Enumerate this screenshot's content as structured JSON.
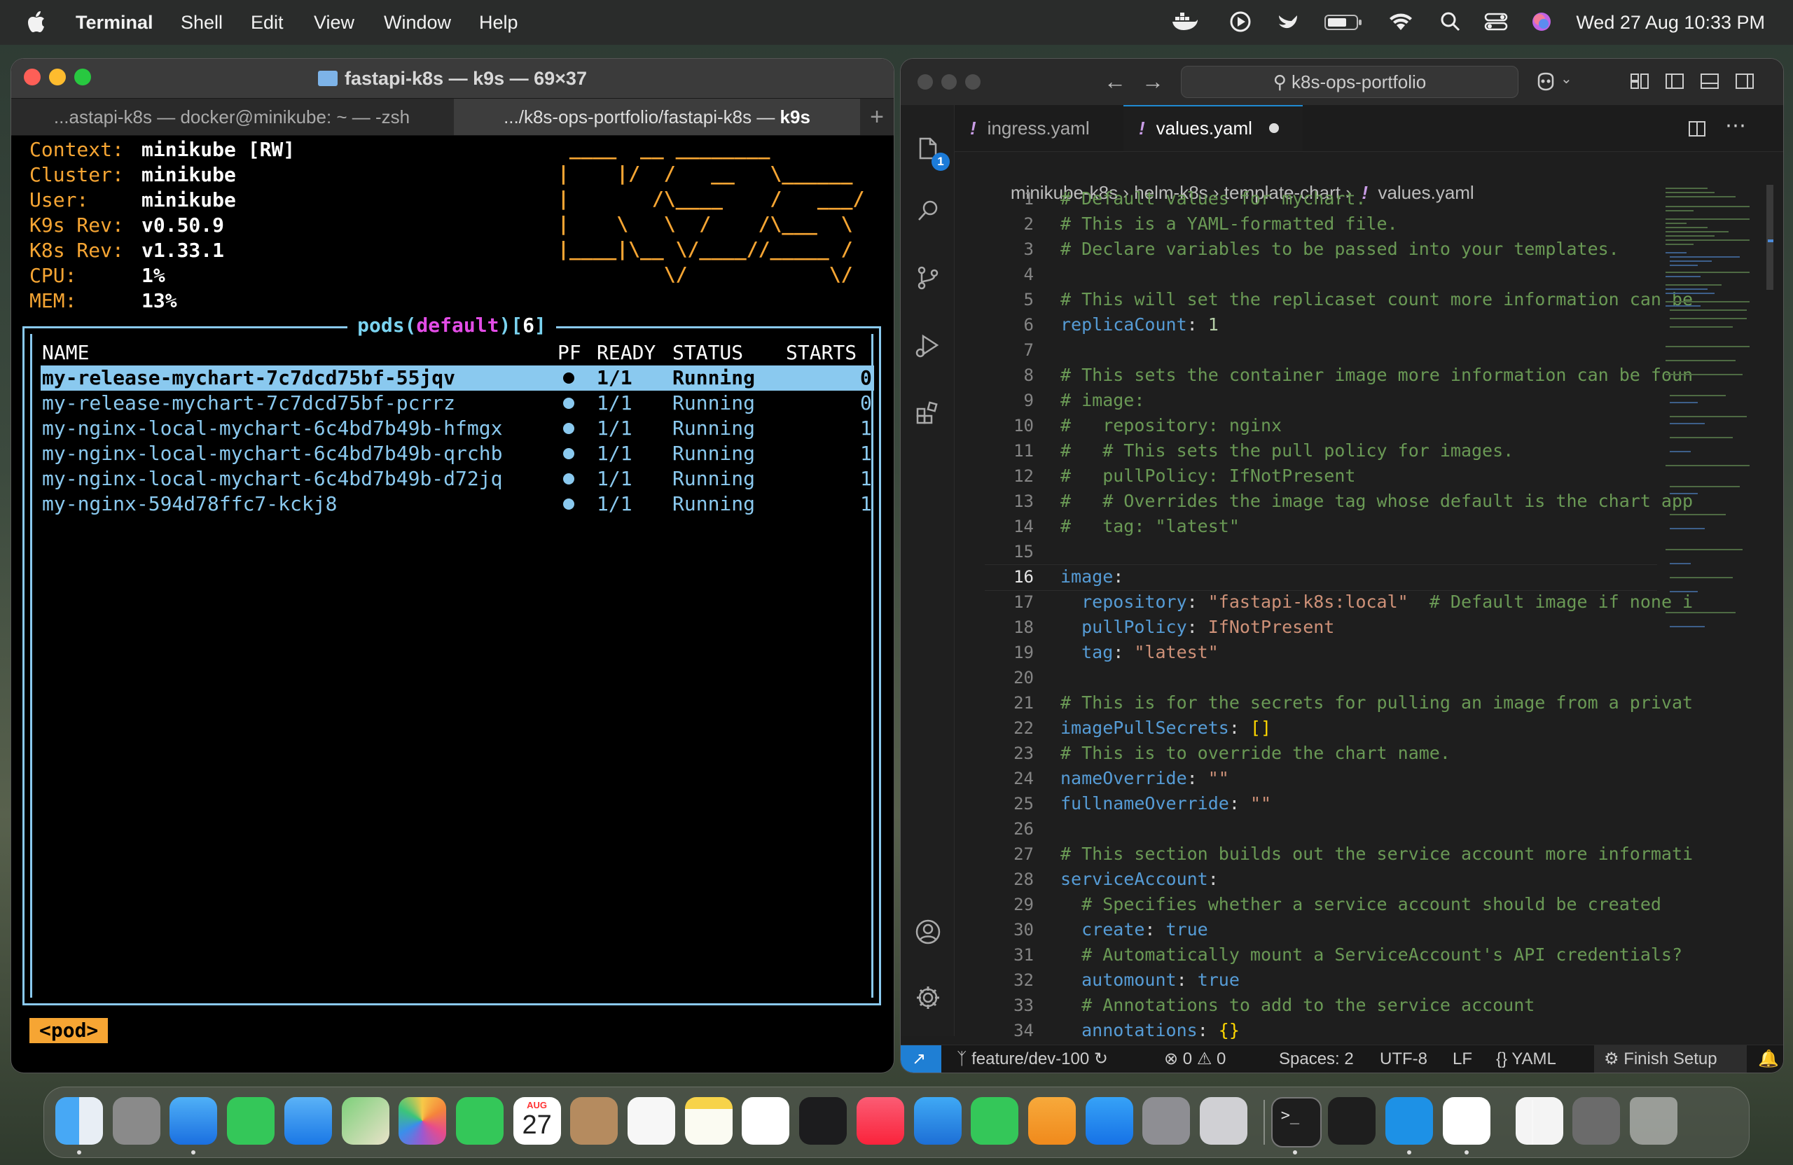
{
  "menubar": {
    "app": "Terminal",
    "items": [
      "Shell",
      "Edit",
      "View",
      "Window",
      "Help"
    ],
    "clock": "Wed 27 Aug  10:33 PM",
    "status_icons": [
      "docker-whale-icon",
      "play-circle-icon",
      "bird-icon",
      "battery-icon",
      "wifi-icon",
      "search-icon",
      "control-center-icon",
      "siri-icon"
    ]
  },
  "terminal": {
    "title": "fastapi-k8s — k9s — 69×37",
    "tabs": [
      {
        "label": "...astapi-k8s — docker@minikube: ~ — -zsh"
      },
      {
        "label": ".../k8s-ops-portfolio/fastapi-k8s — ",
        "tag": "k9s"
      }
    ],
    "info": [
      {
        "label": "Context:",
        "value": "minikube [RW]"
      },
      {
        "label": "Cluster:",
        "value": "minikube"
      },
      {
        "label": "User:",
        "value": "minikube"
      },
      {
        "label": "K9s Rev:",
        "value": "v0.50.9"
      },
      {
        "label": "K8s Rev:",
        "value": "v1.33.1"
      },
      {
        "label": "CPU:",
        "value": "1%"
      },
      {
        "label": "MEM:",
        "value": "13%"
      }
    ],
    "logo": " ____  __ ________        \n|    |/  /   __   \\______ \n|       /\\____    /   ___/\n|    \\   \\  /    /\\___  \\ \n|____|\\__ \\/____//_____ / \n         \\/            \\/  ",
    "pods_title": {
      "word": "pods",
      "ns": "default",
      "count": "6"
    },
    "columns": {
      "name": "NAME",
      "pf": "PF",
      "ready": "READY",
      "status": "STATUS",
      "starts": "STARTS"
    },
    "pods": [
      {
        "name": "my-release-mychart-7c7dcd75bf-55jqv",
        "ready": "1/1",
        "status": "Running",
        "starts": "0"
      },
      {
        "name": "my-release-mychart-7c7dcd75bf-pcrrz",
        "ready": "1/1",
        "status": "Running",
        "starts": "0"
      },
      {
        "name": "my-nginx-local-mychart-6c4bd7b49b-hfmgx",
        "ready": "1/1",
        "status": "Running",
        "starts": "1"
      },
      {
        "name": "my-nginx-local-mychart-6c4bd7b49b-qrchb",
        "ready": "1/1",
        "status": "Running",
        "starts": "1"
      },
      {
        "name": "my-nginx-local-mychart-6c4bd7b49b-d72jq",
        "ready": "1/1",
        "status": "Running",
        "starts": "1"
      },
      {
        "name": "my-nginx-594d78ffc7-kckj8",
        "ready": "1/1",
        "status": "Running",
        "starts": "1"
      }
    ],
    "crumb": "<pod>"
  },
  "vscode": {
    "search": "k8s-ops-portfolio",
    "explorer_badge": "1",
    "tabs": [
      {
        "label": "ingress.yaml",
        "active": false
      },
      {
        "label": "values.yaml",
        "active": true,
        "modified": true
      }
    ],
    "breadcrumb": [
      "minikube-k8s",
      "helm-k8s",
      "template-chart",
      "values.yaml"
    ],
    "current_line": "16",
    "lines": [
      [
        [
          "c-com",
          "# Default values for mychart."
        ]
      ],
      [
        [
          "c-com",
          "# This is a YAML-formatted file."
        ]
      ],
      [
        [
          "c-com",
          "# Declare variables to be passed into your templates."
        ]
      ],
      [],
      [
        [
          "c-com",
          "# This will set the replicaset count more information can be"
        ]
      ],
      [
        [
          "c-key",
          "replicaCount"
        ],
        [
          "c-plain",
          ": "
        ],
        [
          "c-num",
          "1"
        ]
      ],
      [],
      [
        [
          "c-com",
          "# This sets the container image more information can be foun"
        ]
      ],
      [
        [
          "c-com",
          "# image:"
        ]
      ],
      [
        [
          "c-com",
          "#   repository: nginx"
        ]
      ],
      [
        [
          "c-com",
          "#   # This sets the pull policy for images."
        ]
      ],
      [
        [
          "c-com",
          "#   pullPolicy: IfNotPresent"
        ]
      ],
      [
        [
          "c-com",
          "#   # Overrides the image tag whose default is the chart app"
        ]
      ],
      [
        [
          "c-com",
          "#   tag: \"latest\""
        ]
      ],
      [],
      [
        [
          "c-key",
          "image"
        ],
        [
          "c-plain",
          ":"
        ]
      ],
      [
        [
          "c-plain",
          "  "
        ],
        [
          "c-key",
          "repository"
        ],
        [
          "c-plain",
          ": "
        ],
        [
          "c-str",
          "\"fastapi-k8s:local\""
        ],
        [
          "c-plain",
          "  "
        ],
        [
          "c-com",
          "# Default image if none i"
        ]
      ],
      [
        [
          "c-plain",
          "  "
        ],
        [
          "c-key",
          "pullPolicy"
        ],
        [
          "c-plain",
          ": "
        ],
        [
          "c-str",
          "IfNotPresent"
        ]
      ],
      [
        [
          "c-plain",
          "  "
        ],
        [
          "c-key",
          "tag"
        ],
        [
          "c-plain",
          ": "
        ],
        [
          "c-str",
          "\"latest\""
        ]
      ],
      [],
      [
        [
          "c-com",
          "# This is for the secrets for pulling an image from a privat"
        ]
      ],
      [
        [
          "c-key",
          "imagePullSecrets"
        ],
        [
          "c-plain",
          ": "
        ],
        [
          "c-br",
          "[]"
        ]
      ],
      [
        [
          "c-com",
          "# This is to override the chart name."
        ]
      ],
      [
        [
          "c-key",
          "nameOverride"
        ],
        [
          "c-plain",
          ": "
        ],
        [
          "c-str",
          "\"\""
        ]
      ],
      [
        [
          "c-key",
          "fullnameOverride"
        ],
        [
          "c-plain",
          ": "
        ],
        [
          "c-str",
          "\"\""
        ]
      ],
      [],
      [
        [
          "c-com",
          "# This section builds out the service account more informati"
        ]
      ],
      [
        [
          "c-key",
          "serviceAccount"
        ],
        [
          "c-plain",
          ":"
        ]
      ],
      [
        [
          "c-plain",
          "  "
        ],
        [
          "c-com",
          "# Specifies whether a service account should be created"
        ]
      ],
      [
        [
          "c-plain",
          "  "
        ],
        [
          "c-key",
          "create"
        ],
        [
          "c-plain",
          ": "
        ],
        [
          "c-bool",
          "true"
        ]
      ],
      [
        [
          "c-plain",
          "  "
        ],
        [
          "c-com",
          "# Automatically mount a ServiceAccount's API credentials?"
        ]
      ],
      [
        [
          "c-plain",
          "  "
        ],
        [
          "c-key",
          "automount"
        ],
        [
          "c-plain",
          ": "
        ],
        [
          "c-bool",
          "true"
        ]
      ],
      [
        [
          "c-plain",
          "  "
        ],
        [
          "c-com",
          "# Annotations to add to the service account"
        ]
      ],
      [
        [
          "c-plain",
          "  "
        ],
        [
          "c-key",
          "annotations"
        ],
        [
          "c-plain",
          ": "
        ],
        [
          "c-br",
          "{}"
        ]
      ]
    ],
    "status": {
      "branch": "feature/dev-100",
      "errors": "0",
      "warnings": "0",
      "spaces": "Spaces: 2",
      "encoding": "UTF-8",
      "eol": "LF",
      "language": "YAML",
      "finish": "Finish Setup"
    }
  },
  "dock": {
    "calendar_month": "AUG",
    "calendar_day": "27",
    "apps": [
      "finder-icon",
      "launchpad-icon",
      "safari-icon",
      "messages-icon",
      "mail-icon",
      "maps-icon",
      "photos-icon",
      "facetime-icon",
      "calendar-icon",
      "contacts-icon",
      "reminders-icon",
      "notes-icon",
      "freeform-icon",
      "tv-icon",
      "music-icon",
      "keynote-icon",
      "numbers-icon",
      "pages-icon",
      "app-store-icon",
      "system-settings-icon",
      "iphone-mirroring-icon",
      "terminal-icon",
      "activity-monitor-icon",
      "docker-icon",
      "vscode-icon",
      "preview-icon",
      "downloads-stack-icon",
      "trash-icon"
    ]
  }
}
